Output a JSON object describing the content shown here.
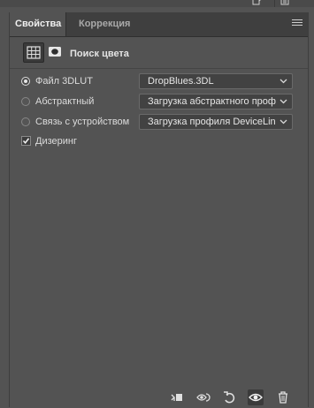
{
  "tabs": [
    {
      "label": "Свойства",
      "active": true
    },
    {
      "label": "Коррекция",
      "active": false
    }
  ],
  "header": {
    "title": "Поиск цвета",
    "icons": [
      "adjustment-layer-icon",
      "layer-mask-icon"
    ]
  },
  "options": [
    {
      "label": "Файл 3DLUT",
      "selected": true,
      "value": "DropBlues.3DL"
    },
    {
      "label": "Абстрактный",
      "selected": false,
      "value": "Загрузка абстрактного профи..."
    },
    {
      "label": "Связь с устройством",
      "selected": false,
      "value": "Загрузка профиля DeviceLink..."
    }
  ],
  "dither": {
    "label": "Дизеринг",
    "checked": true
  },
  "bottom_icons": [
    "clip-to-layer-icon",
    "view-previous-state-icon",
    "reset-icon",
    "visibility-eye-icon",
    "delete-trash-icon"
  ],
  "colors": {
    "panel": "#535353",
    "tabbar": "#3f3f3f",
    "field": "#424242",
    "text": "#dcdcdc"
  }
}
